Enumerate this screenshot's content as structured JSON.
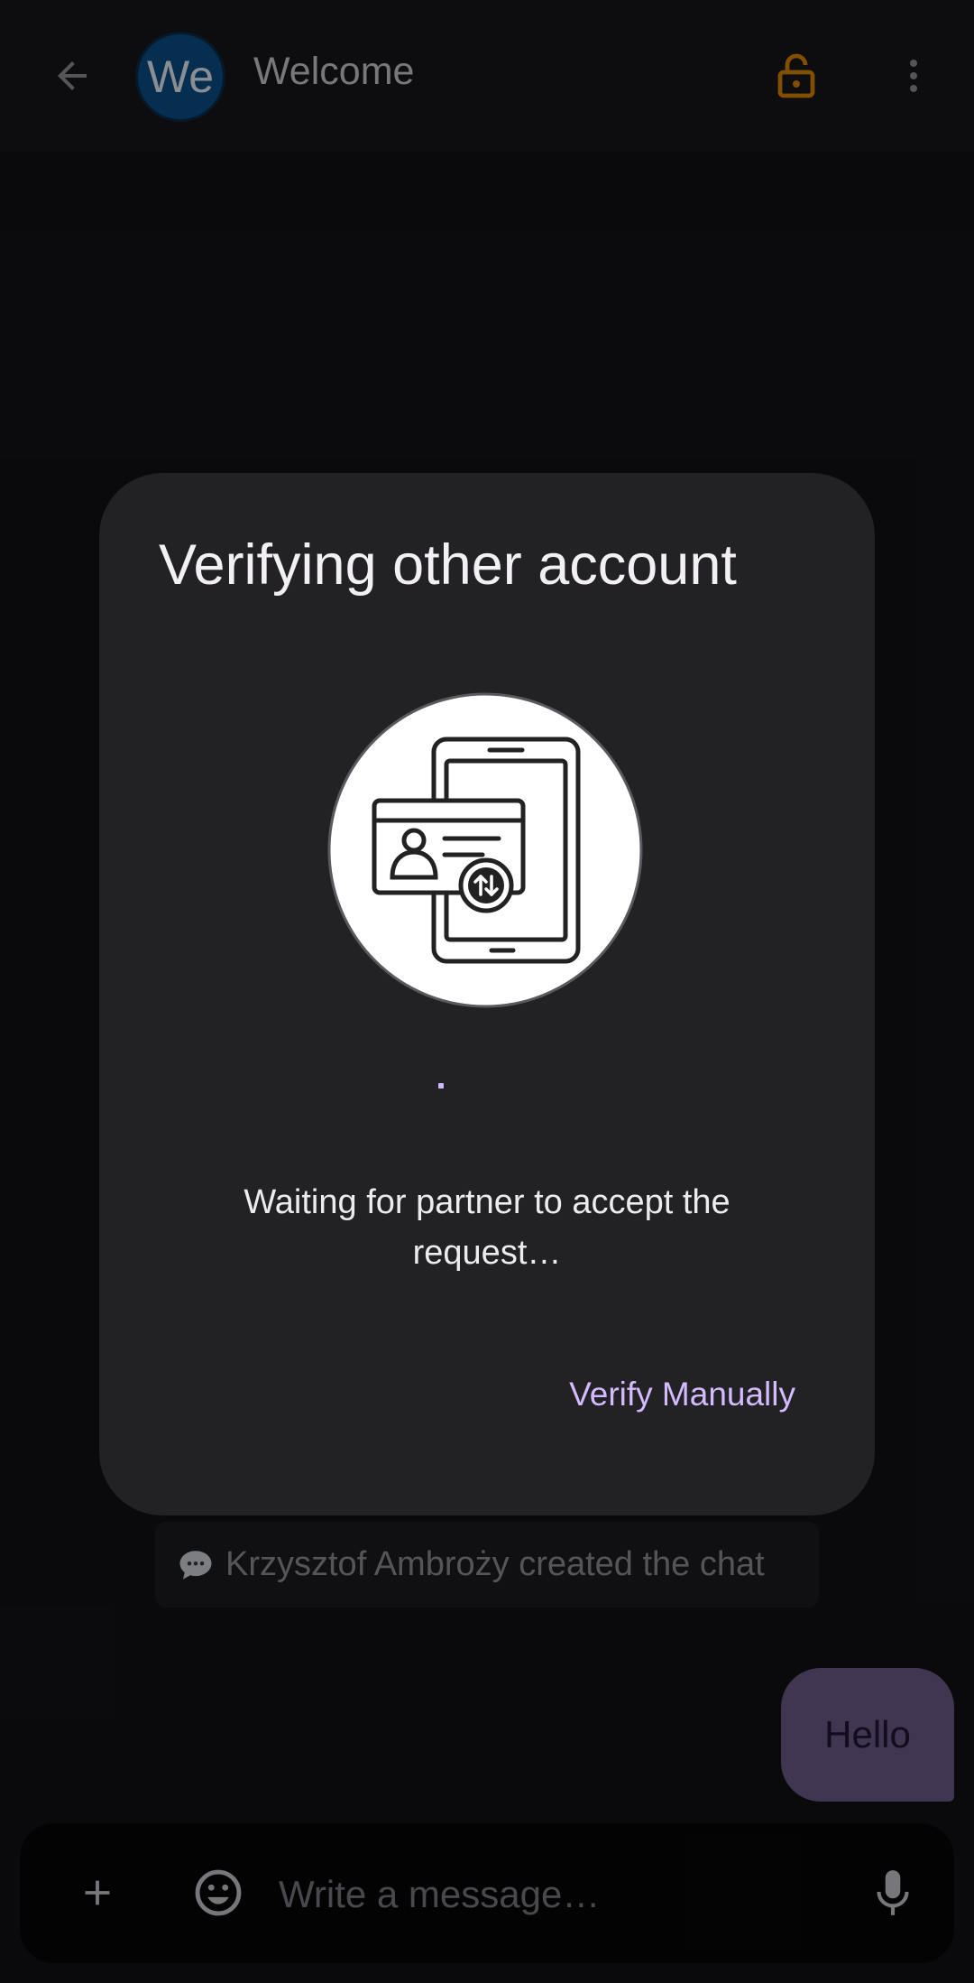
{
  "appbar": {
    "avatar_initials": "We",
    "title": "Welcome",
    "icons": {
      "back": "arrow-back-icon",
      "lock": "lock-open-icon",
      "more": "more-vert-icon"
    },
    "lock_color": "#d98200"
  },
  "dialog": {
    "title": "Verifying other account",
    "illustration": "phone-id-card-verification-illustration",
    "waiting_text": "Waiting for partner to accept the request…",
    "verify_manually_label": "Verify Manually"
  },
  "timeline": {
    "system_message": "Krzysztof Ambroży created the chat",
    "system_icon": "speech-bubble-icon",
    "outgoing_message": "Hello"
  },
  "composer": {
    "placeholder": "Write a message…",
    "icons": {
      "add": "add-icon",
      "emoji": "emoji-icon",
      "mic": "mic-icon"
    }
  },
  "colors": {
    "accent": "#d4bbff",
    "bubble": "#6c5a88",
    "avatar": "#0a4d86"
  }
}
